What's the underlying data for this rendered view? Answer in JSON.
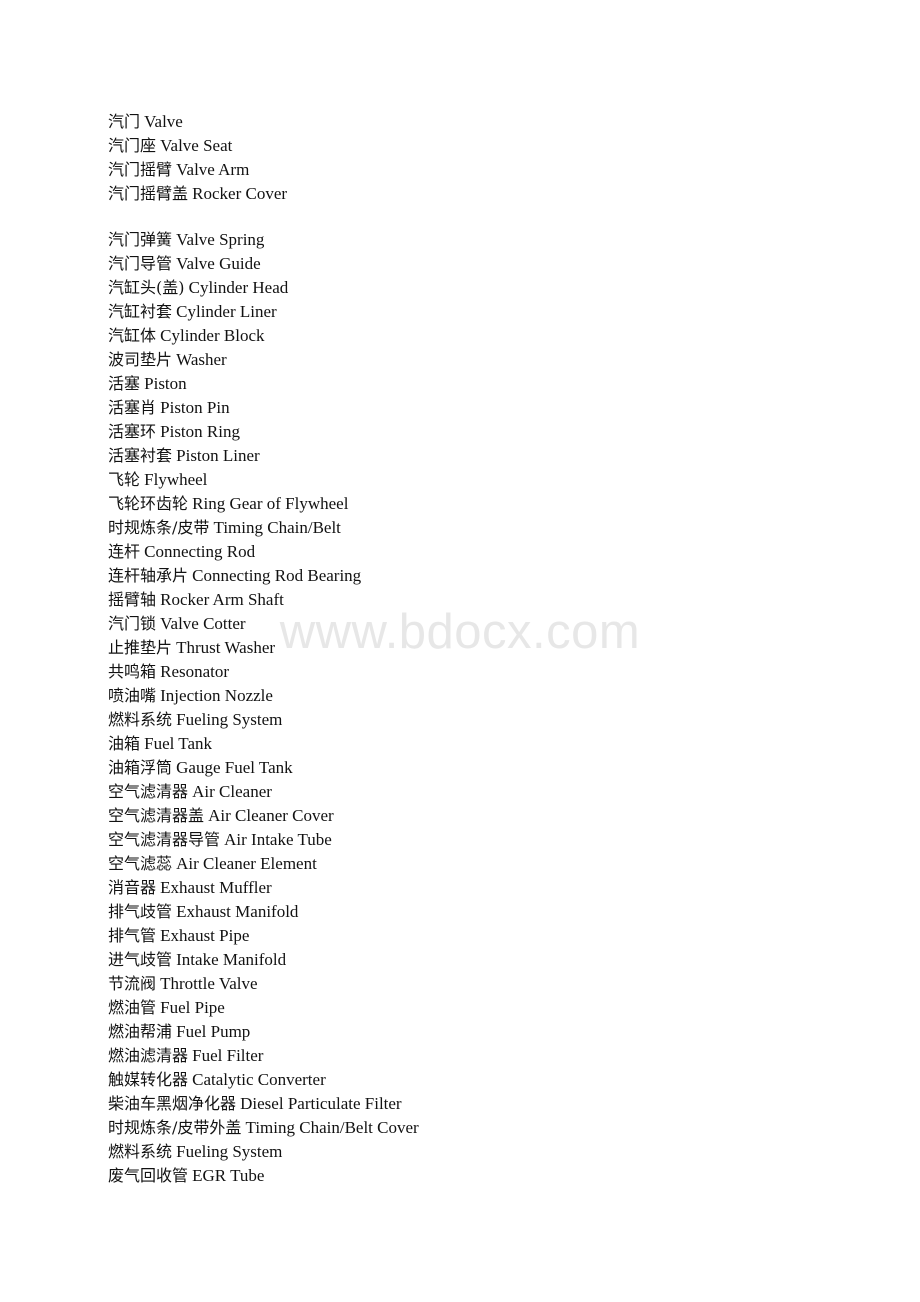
{
  "document": {
    "page_background": "#ffffff",
    "text_color": "#121212",
    "watermark": {
      "text": "www.bdocx.com",
      "color": "#e7e7e7"
    }
  },
  "glossary": {
    "lines": [
      {
        "cn": "汽门",
        "en": "Valve"
      },
      {
        "cn": "汽门座",
        "en": "Valve Seat"
      },
      {
        "cn": "汽门摇臂",
        "en": "Valve Arm"
      },
      {
        "cn": "汽门摇臂盖",
        "en": "Rocker Cover"
      },
      {
        "blank": true
      },
      {
        "cn": "汽门弹簧",
        "en": "Valve Spring"
      },
      {
        "cn": "汽门导管",
        "en": "Valve Guide"
      },
      {
        "cn": "汽缸头(盖)",
        "en": "Cylinder Head"
      },
      {
        "cn": "汽缸衬套",
        "en": "Cylinder Liner"
      },
      {
        "cn": "汽缸体",
        "en": "Cylinder Block"
      },
      {
        "cn": "波司垫片",
        "en": "Washer"
      },
      {
        "cn": "活塞",
        "en": "Piston"
      },
      {
        "cn": "活塞肖",
        "en": "Piston Pin"
      },
      {
        "cn": "活塞环",
        "en": "Piston Ring"
      },
      {
        "cn": "活塞衬套",
        "en": "Piston Liner"
      },
      {
        "cn": "飞轮",
        "en": "Flywheel"
      },
      {
        "cn": "飞轮环齿轮",
        "en": "Ring Gear of Flywheel"
      },
      {
        "cn": "时规炼条/皮带",
        "en": "Timing Chain/Belt"
      },
      {
        "cn": "连杆",
        "en": "Connecting Rod"
      },
      {
        "cn": "连杆轴承片",
        "en": "Connecting Rod Bearing"
      },
      {
        "cn": "摇臂轴",
        "en": "Rocker Arm Shaft"
      },
      {
        "cn": "汽门锁",
        "en": "Valve Cotter"
      },
      {
        "cn": "止推垫片",
        "en": "Thrust Washer"
      },
      {
        "cn": "共鸣箱",
        "en": "Resonator"
      },
      {
        "cn": "喷油嘴",
        "en": "Injection Nozzle"
      },
      {
        "cn": "燃料系统",
        "en": "Fueling System"
      },
      {
        "cn": "油箱",
        "en": "Fuel Tank"
      },
      {
        "cn": "油箱浮筒",
        "en": "Gauge Fuel Tank"
      },
      {
        "cn": "空气滤清器",
        "en": "Air Cleaner"
      },
      {
        "cn": "空气滤清器盖",
        "en": "Air Cleaner Cover"
      },
      {
        "cn": "空气滤清器导管",
        "en": "Air Intake Tube"
      },
      {
        "cn": "空气滤蕊",
        "en": "Air Cleaner Element"
      },
      {
        "cn": "消音器",
        "en": "Exhaust Muffler"
      },
      {
        "cn": "排气歧管",
        "en": "Exhaust Manifold"
      },
      {
        "cn": "排气管",
        "en": "Exhaust Pipe"
      },
      {
        "cn": "进气歧管",
        "en": "Intake Manifold"
      },
      {
        "cn": "节流阀",
        "en": "Throttle Valve"
      },
      {
        "cn": "燃油管",
        "en": "Fuel Pipe"
      },
      {
        "cn": "燃油帮浦",
        "en": "Fuel Pump"
      },
      {
        "cn": "燃油滤清器",
        "en": "Fuel Filter"
      },
      {
        "cn": "触媒转化器",
        "en": "Catalytic Converter"
      },
      {
        "cn": "柴油车黑烟净化器",
        "en": "Diesel Particulate Filter"
      },
      {
        "cn": "时规炼条/皮带外盖",
        "en": "Timing Chain/Belt Cover"
      },
      {
        "cn": "燃料系统",
        "en": "Fueling System"
      },
      {
        "cn": "废气回收管",
        "en": "EGR Tube"
      }
    ]
  }
}
